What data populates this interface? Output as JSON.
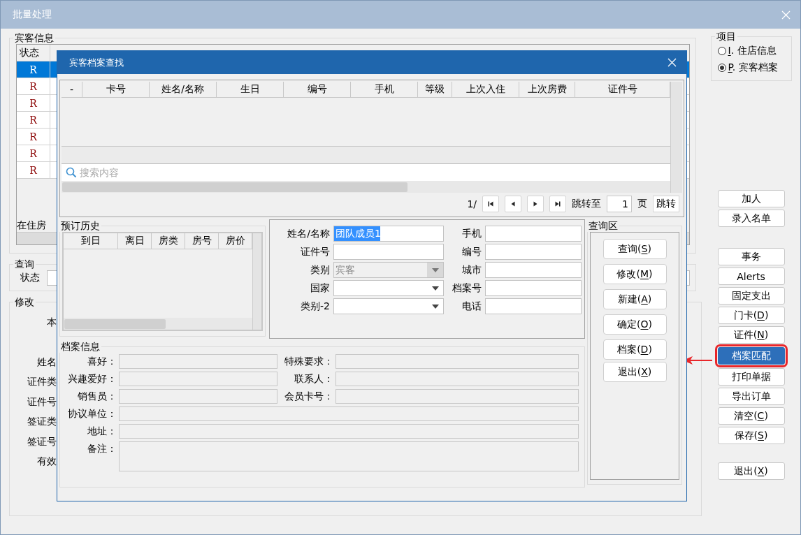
{
  "window": {
    "title": "批量处理"
  },
  "guest_info": {
    "title": "宾客信息",
    "columns": [
      "状态"
    ],
    "rows": [
      {
        "status": "R",
        "selected": true
      },
      {
        "status": "R",
        "selected": false
      },
      {
        "status": "R",
        "selected": false
      },
      {
        "status": "R",
        "selected": false
      },
      {
        "status": "R",
        "selected": false
      },
      {
        "status": "R",
        "selected": false
      },
      {
        "status": "R",
        "selected": false
      }
    ],
    "footer_label": "在住房"
  },
  "query": {
    "title": "查询",
    "label": "状态"
  },
  "modify": {
    "title": "修改",
    "labels": [
      "本",
      "姓名",
      "证件类",
      "证件号",
      "签证类",
      "签证号",
      "有效"
    ]
  },
  "items_group": {
    "title": "项目",
    "options": [
      {
        "key": "I",
        "label": ". 住店信息",
        "selected": false
      },
      {
        "key": "P",
        "label": ". 宾客档案",
        "selected": true
      }
    ]
  },
  "side_buttons": [
    [
      {
        "label": "加人",
        "highlighted": false
      },
      {
        "label": "录入名单",
        "highlighted": false
      }
    ],
    [
      {
        "label": "事务",
        "highlighted": false
      },
      {
        "label": "Alerts",
        "highlighted": false
      },
      {
        "label": "固定支出",
        "highlighted": false
      },
      {
        "label": "门卡(",
        "key": "D",
        "after": ")",
        "highlighted": false
      },
      {
        "label": "证件(",
        "key": "N",
        "after": ")",
        "highlighted": false
      },
      {
        "label": "档案匹配",
        "highlighted": true
      },
      {
        "label": "打印单据",
        "highlighted": false
      },
      {
        "label": "导出订单",
        "highlighted": false
      },
      {
        "label": "清空(",
        "key": "C",
        "after": ")",
        "highlighted": false
      },
      {
        "label": "保存(",
        "key": "S",
        "after": ")",
        "highlighted": false
      }
    ],
    [
      {
        "label": "退出(",
        "key": "X",
        "after": ")",
        "highlighted": false
      }
    ]
  ],
  "dialog": {
    "title": "宾客档案查找",
    "results": {
      "columns": [
        "-",
        "卡号",
        "姓名/名称",
        "生日",
        "编号",
        "手机",
        "等级",
        "上次入住",
        "上次房费",
        "证件号"
      ],
      "search": {
        "placeholder": "搜索内容"
      },
      "pager": {
        "page": "1/",
        "jump_label": "跳转至",
        "page_input": "1",
        "page_unit": "页",
        "jump_button": "跳转"
      }
    },
    "booking_history": {
      "title": "预订历史",
      "columns": [
        "到日",
        "离日",
        "房类",
        "房号",
        "房价"
      ]
    },
    "form": {
      "fields": [
        {
          "label": "姓名/名称",
          "kind": "text",
          "value": "团队成员1",
          "highlighted": true
        },
        {
          "label": "手机",
          "kind": "text",
          "highlighted": false
        },
        {
          "label": "证件号",
          "kind": "text",
          "highlighted": false
        },
        {
          "label": "编号",
          "kind": "text",
          "highlighted": false
        },
        {
          "label": "类别",
          "kind": "dropdown",
          "value": "宾客",
          "disabled": true
        },
        {
          "label": "城市",
          "kind": "text",
          "highlighted": false
        },
        {
          "label": "国家",
          "kind": "dropdown",
          "disabled": false
        },
        {
          "label": "档案号",
          "kind": "text",
          "highlighted": false
        },
        {
          "label": "类别-2",
          "kind": "dropdown",
          "disabled": false
        },
        {
          "label": "电话",
          "kind": "text",
          "highlighted": false
        }
      ]
    },
    "profile": {
      "title": "档案信息",
      "fields": [
        {
          "label": "喜好：",
          "kind": "half"
        },
        {
          "label": "特殊要求：",
          "kind": "half"
        },
        {
          "label": "兴趣爱好：",
          "kind": "half"
        },
        {
          "label": "联系人：",
          "kind": "half"
        },
        {
          "label": "销售员：",
          "kind": "half"
        },
        {
          "label": "会员卡号：",
          "kind": "half"
        },
        {
          "label": "协议单位：",
          "kind": "full"
        },
        {
          "label": "地址：",
          "kind": "full"
        },
        {
          "label": "备注：",
          "kind": "multiline"
        }
      ]
    },
    "query_area": {
      "title": "查询区",
      "buttons": [
        {
          "label": "查询(",
          "key": "S",
          "after": ")"
        },
        {
          "label": "修改(",
          "key": "M",
          "after": ")"
        },
        {
          "label": "新建(",
          "key": "A",
          "after": ")"
        },
        {
          "label": "确定(",
          "key": "O",
          "after": ")"
        },
        {
          "label": "档案(",
          "key": "D",
          "after": ")"
        },
        {
          "label": "退出(",
          "key": "X",
          "after": ")"
        }
      ]
    }
  }
}
